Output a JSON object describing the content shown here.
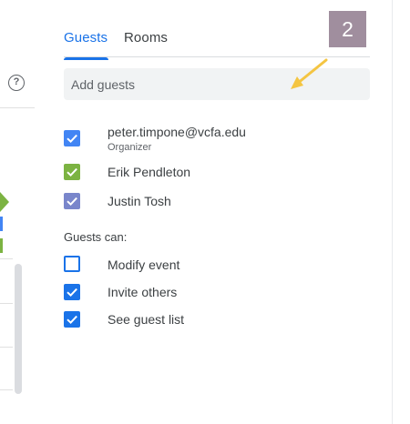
{
  "left_panel": {
    "help_icon": "help-circle-icon",
    "help_glyph": "?"
  },
  "tabs": [
    {
      "label": "Guests",
      "active": true
    },
    {
      "label": "Rooms",
      "active": false
    }
  ],
  "badge": {
    "text": "2",
    "color": "#a08e9e"
  },
  "add_guests": {
    "placeholder": "Add guests"
  },
  "guests": [
    {
      "name": "peter.timpone@vcfa.edu",
      "role": "Organizer",
      "checkbox_color": "#4285f4",
      "checked": true
    },
    {
      "name": "Erik Pendleton",
      "checkbox_color": "#7cb342",
      "checked": true
    },
    {
      "name": "Justin Tosh",
      "checkbox_color": "#7986cb",
      "checked": true
    }
  ],
  "permissions": {
    "title": "Guests can:",
    "items": [
      {
        "label": "Modify event",
        "checked": false
      },
      {
        "label": "Invite others",
        "checked": true
      },
      {
        "label": "See guest list",
        "checked": true
      }
    ]
  },
  "colors": {
    "accent": "#1a73e8",
    "arrow": "#f4c542"
  }
}
